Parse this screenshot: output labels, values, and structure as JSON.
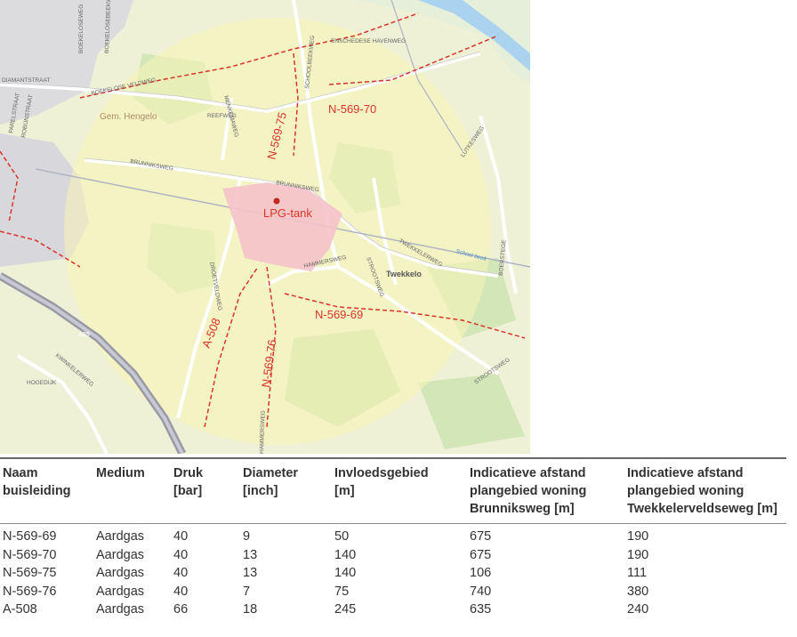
{
  "map": {
    "labels": {
      "lpg_tank": "LPG-tank",
      "pipe_n56970": "N-569-70",
      "pipe_n56975": "N-569-75",
      "pipe_n56969": "N-569-69",
      "pipe_a508": "A-508",
      "pipe_n56976": "N-569-76",
      "municipality": "Gem. Hengelo",
      "village": "Twekkelo",
      "highway": "A35"
    },
    "streets": {
      "diamantstraat": "DIAMANTSTRAAT",
      "parelstraat": "PARELSTRAAT",
      "robijnstraat": "ROBIJNSTRAAT",
      "boekeloseweg": "BOEKELOSEWEG",
      "boekelosebeekweg": "BOEKELOSEBEEKWEG",
      "boekelose_veldweg": "BOEKELOSE VELDWEG",
      "enschedese_havenweg": "ENSCHEDESE HAVENWEG",
      "schoolbeekweg": "SCHOOLBEEKWEG",
      "menkemaweg": "MENKEMAWEG",
      "reefweg": "REEFWEG",
      "brunniksweg": "BRUNNIKSWEG",
      "brunniksweg2": "BRUNNIKSWEG",
      "twekkelerweg": "TWEKKELERWEG",
      "hammersweg": "HAMMERSWEG",
      "strootsweg": "STROOTSWEG",
      "strootsweg2": "STROOTSWEG",
      "lutkeweg": "LUTKESWEG",
      "boerstege": "BOERSTEGE",
      "hogedijk": "HOGEDIJK",
      "kwinkelerweg": "KWINKELERWEG",
      "drielenveldweg": "DROETVELDWEG",
      "hammersweg2": "HAMMERSWEG",
      "schoolbeek": "School beek"
    },
    "colors": {
      "base": "#eef3d2",
      "influence_zone": "#f7f4b8",
      "lpg_zone": "#f6c6cd",
      "pipeline": "#d9342b",
      "road_outline": "#bdbdbd",
      "water": "#a8d4f0",
      "urban": "#d9d9de",
      "forest": "#cfe3b1"
    }
  },
  "table": {
    "headers": {
      "name": [
        "Naam",
        "buisleiding"
      ],
      "medium": [
        "Medium"
      ],
      "pressure": [
        "Druk",
        "[bar]"
      ],
      "diameter": [
        "Diameter",
        "[inch]"
      ],
      "influence": [
        "Invloedsgebied",
        "[m]"
      ],
      "dist_brunniksweg": [
        "Indicatieve afstand",
        "plangebied woning",
        "Brunniksweg [m]"
      ],
      "dist_twekkeler": [
        "Indicatieve afstand",
        "plangebied woning",
        "Twekkelerveldseweg [m]"
      ]
    },
    "rows": [
      [
        "N-569-69",
        "Aardgas",
        "40",
        "9",
        "50",
        "675",
        "190"
      ],
      [
        "N-569-70",
        "Aardgas",
        "40",
        "13",
        "140",
        "675",
        "190"
      ],
      [
        "N-569-75",
        "Aardgas",
        "40",
        "13",
        "140",
        "106",
        "111"
      ],
      [
        "N-569-76",
        "Aardgas",
        "40",
        "7",
        "75",
        "740",
        "380"
      ],
      [
        "A-508",
        "Aardgas",
        "66",
        "18",
        "245",
        "635",
        "240"
      ]
    ]
  }
}
